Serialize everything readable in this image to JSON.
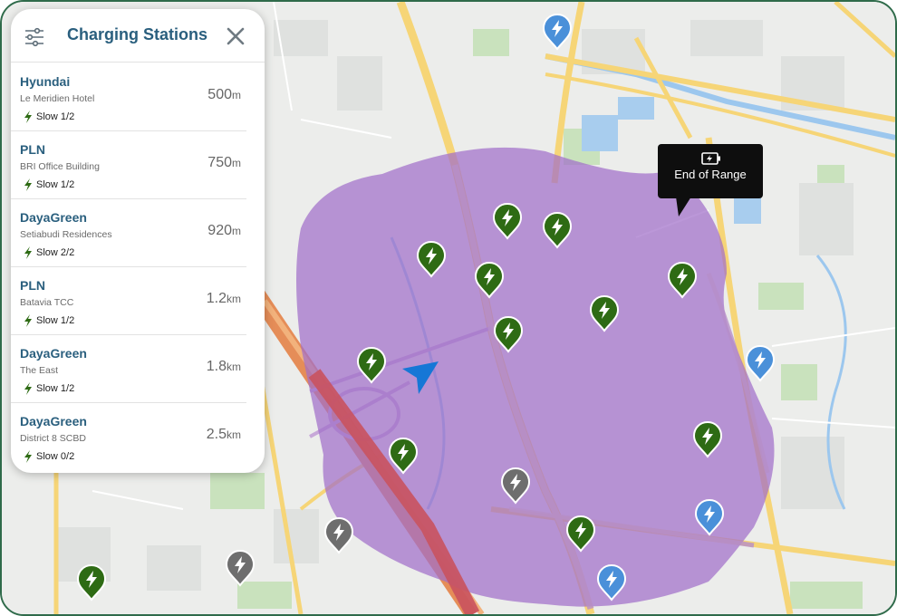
{
  "panel": {
    "title": "Charging Stations",
    "filter_icon": "sliders-icon",
    "close_icon": "close-icon"
  },
  "stations": [
    {
      "brand": "Hyundai",
      "address": "Le Meridien Hotel",
      "slow": "Slow 1/2",
      "distance": "500",
      "unit": "m"
    },
    {
      "brand": "PLN",
      "address": "BRI Office Building",
      "slow": "Slow 1/2",
      "distance": "750",
      "unit": "m"
    },
    {
      "brand": "DayaGreen",
      "address": "Setiabudi Residences",
      "slow": "Slow 2/2",
      "distance": "920",
      "unit": "m"
    },
    {
      "brand": "PLN",
      "address": "Batavia TCC",
      "slow": "Slow 1/2",
      "distance": "1.2",
      "unit": "km"
    },
    {
      "brand": "DayaGreen",
      "address": "The East",
      "slow": "Slow 1/2",
      "distance": "1.8",
      "unit": "km"
    },
    {
      "brand": "DayaGreen",
      "address": "District 8 SCBD",
      "slow": "Slow 0/2",
      "distance": "2.5",
      "unit": "km"
    }
  ],
  "tooltip": {
    "text": "End of Range",
    "icon": "battery-charging-icon"
  },
  "colors": {
    "accent": "#2a5f7e",
    "range_overlay": "#a877cc",
    "marker_green": "#2e6b14",
    "marker_gray": "#6e6e6e",
    "marker_blue": "#4a90d9",
    "nav_arrow": "#1677d6",
    "bolt_green": "#2e6b14"
  }
}
